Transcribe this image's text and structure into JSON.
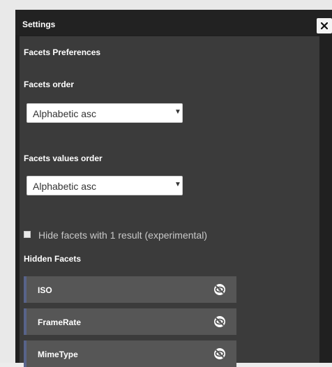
{
  "dialog": {
    "title": "Settings",
    "close_icon": "close-icon"
  },
  "panel": {
    "section_title": "Facets Preferences",
    "facets_order": {
      "label": "Facets order",
      "selected": "Alphabetic asc"
    },
    "facets_values_order": {
      "label": "Facets values order",
      "selected": "Alphabetic asc"
    },
    "hide_single_result": {
      "label": "Hide facets with 1 result (experimental)",
      "checked": false
    },
    "hidden_facets": {
      "title": "Hidden Facets",
      "items": [
        {
          "label": "ISO",
          "icon": "eye-slash-icon"
        },
        {
          "label": "FrameRate",
          "icon": "eye-slash-icon"
        },
        {
          "label": "MimeType",
          "icon": "eye-slash-icon"
        }
      ]
    }
  },
  "colors": {
    "dialog_bg": "#202020",
    "panel_bg": "#3b3b3b",
    "item_bg": "#565656",
    "item_accent": "#58638a"
  }
}
